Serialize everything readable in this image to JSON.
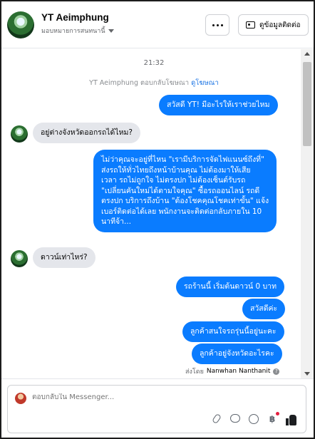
{
  "header": {
    "page_name": "YT Aeimphung",
    "subtitle": "มอบหมายการสนทนานี้",
    "contact_button_label": "ดูข้อมูลติดต่อ"
  },
  "chat": {
    "timestamp": "21:32",
    "reply_note_prefix": "YT Aeimphung ตอบกลับโฆษณา ",
    "reply_note_link": "ดูโฆษณา",
    "messages": [
      {
        "side": "out",
        "text": "สวัสดี YT! มีอะไรให้เราช่วยไหม"
      },
      {
        "side": "in",
        "text": "อยู่ต่างจังหวัดออกรถได้ไหม?"
      },
      {
        "side": "out",
        "lines": [
          "ไม่ว่าคุณจะอยู่ที่ไหน \"เรามีบริการจัดไฟแนนซ์ถึงที่\"",
          "ส่งรถให้ทั่วไทยถึงหน้าบ้านคุณ ไม่ต้องมาให้เสีย",
          "เวลา รถไม่ถูกใจ ไม่ตรงปก ไม่ต้องเซ็นต์รับรถ",
          "\"เปลี่ยนคันใหม่ได้ตามใจคุณ\" ซื้อรถออนไลน์ รถดี",
          "ตรงปก บริการถึงบ้าน \"ต้องโชคคุณโชคเท่าขั้น\" แจ้ง",
          "เบอร์ติดต่อได้เลย พนักงานจะติดต่อกลับภายใน 10",
          "นาทีจ้า..."
        ]
      },
      {
        "side": "in",
        "text": "ดาวน์เท่าไหร่?"
      },
      {
        "side": "out",
        "text": "รถร้านนี้ เริ่มต้นดาวน์ 0 บาท"
      },
      {
        "side": "out",
        "text": "สวัสดีค่ะ"
      },
      {
        "side": "out",
        "text": "ลูกค้าสนใจรถรุ่นนี้อยู่นะคะ"
      },
      {
        "side": "out",
        "text": "ลูกค้าอยู่จังหวัดอะไรคะ"
      }
    ],
    "sent_by_prefix": "ส่งโดย",
    "sent_by_name": "Nanwhan Nanthanit"
  },
  "composer": {
    "placeholder": "ตอบกลับใน Messenger..."
  },
  "icons": {
    "more": "more-dots-icon",
    "contact": "contact-card-icon",
    "attach": "paperclip-icon",
    "saved_reply": "chat-bubble-icon",
    "emoji": "smile-icon",
    "coin": "baht-coin-icon",
    "like": "thumbs-up-icon"
  },
  "colors": {
    "outgoing_bubble": "#0a7cff",
    "incoming_bubble": "#e4e6eb",
    "link": "#1b74e4"
  }
}
